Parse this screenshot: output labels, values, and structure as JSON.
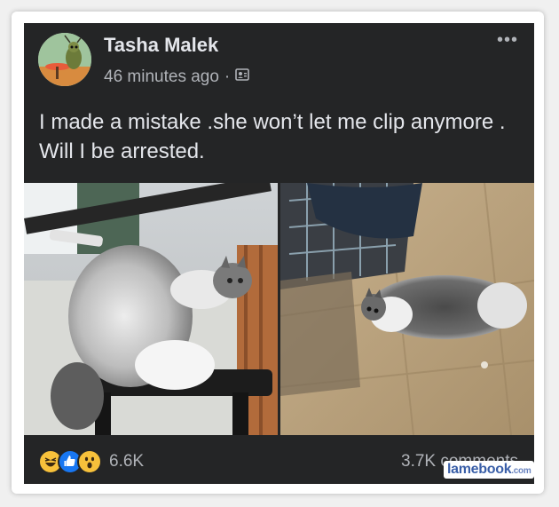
{
  "post": {
    "author": "Tasha Malek",
    "time": "46 minutes ago",
    "separator": "·",
    "privacy_icon": "custom-audience-icon",
    "text": "I made a mistake .she won’t let me clip anymore . Will I be arrested."
  },
  "reactions": {
    "icons": [
      "haha-emoji",
      "like-emoji",
      "wow-emoji"
    ],
    "count": "6.6K"
  },
  "comments": {
    "label": "3.7K comments"
  },
  "watermark": {
    "text": "lamebook",
    "suffix": ".com"
  },
  "colors": {
    "card_bg": "#242526",
    "text": "#e4e6eb",
    "muted": "#b0b3b8",
    "like_blue": "#1877f2",
    "emoji_yellow": "#f7c13b"
  }
}
